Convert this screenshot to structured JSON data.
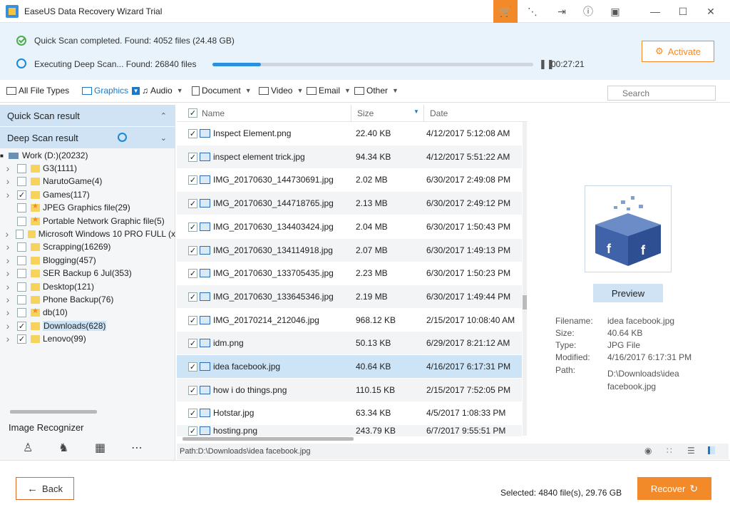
{
  "app": {
    "title": "EaseUS Data Recovery Wizard Trial"
  },
  "titlebar_icons": [
    "cart-icon",
    "share-icon",
    "exit-icon",
    "help-icon",
    "menu-icon",
    "minimize-icon",
    "maximize-icon",
    "close-icon"
  ],
  "status": {
    "quick_scan": "Quick Scan completed.  Found: 4052 files (24.48 GB)",
    "deep_scan": "Executing Deep Scan... Found: 26840 files",
    "progress": 0.15,
    "elapsed": "00:27:21",
    "activate_label": "Activate"
  },
  "filters": [
    {
      "label": "All File Types",
      "icon": "monitor-icon"
    },
    {
      "label": "Graphics",
      "icon": "image-icon"
    },
    {
      "label": "Audio",
      "icon": "music-icon"
    },
    {
      "label": "Document",
      "icon": "document-icon"
    },
    {
      "label": "Video",
      "icon": "video-icon"
    },
    {
      "label": "Email",
      "icon": "email-icon"
    },
    {
      "label": "Other",
      "icon": "folder-icon"
    }
  ],
  "search_placeholder": "Search",
  "sidebar": {
    "quick_scan_result": "Quick Scan result",
    "deep_scan_result": "Deep Scan result",
    "root": "Work (D:)(20232)",
    "items": [
      {
        "label": "G3(1111)",
        "checked": false,
        "arrow": true,
        "star": false
      },
      {
        "label": "NarutoGame(4)",
        "checked": false,
        "arrow": true,
        "star": false
      },
      {
        "label": "Games(117)",
        "checked": true,
        "arrow": true,
        "star": false
      },
      {
        "label": "JPEG Graphics file(29)",
        "checked": false,
        "arrow": false,
        "star": true
      },
      {
        "label": "Portable Network Graphic file(5)",
        "checked": false,
        "arrow": false,
        "star": true
      },
      {
        "label": "Microsoft Windows 10 PRO FULL (x",
        "checked": false,
        "arrow": true,
        "star": false
      },
      {
        "label": "Scrapping(16269)",
        "checked": false,
        "arrow": true,
        "star": false
      },
      {
        "label": "Blogging(457)",
        "checked": false,
        "arrow": true,
        "star": false
      },
      {
        "label": "SER Backup 6 Jul(353)",
        "checked": false,
        "arrow": true,
        "star": false
      },
      {
        "label": "Desktop(121)",
        "checked": false,
        "arrow": true,
        "star": false
      },
      {
        "label": "Phone Backup(76)",
        "checked": false,
        "arrow": true,
        "star": false
      },
      {
        "label": "db(10)",
        "checked": false,
        "arrow": true,
        "star": true
      },
      {
        "label": "Downloads(628)",
        "checked": true,
        "arrow": true,
        "star": false,
        "selected": true
      },
      {
        "label": "Lenovo(99)",
        "checked": true,
        "arrow": true,
        "star": false
      }
    ],
    "image_recognizer": "Image Recognizer",
    "recognizer_icons": [
      "person-icon",
      "animal-icon",
      "building-icon",
      "more-icon"
    ]
  },
  "list": {
    "col_name": "Name",
    "col_size": "Size",
    "col_date": "Date",
    "rows": [
      {
        "name": "Inspect Element.png",
        "size": "22.40 KB",
        "date": "4/12/2017 5:12:08 AM"
      },
      {
        "name": "inspect element trick.jpg",
        "size": "94.34 KB",
        "date": "4/12/2017 5:51:22 AM"
      },
      {
        "name": "IMG_20170630_144730691.jpg",
        "size": "2.02 MB",
        "date": "6/30/2017 2:49:08 PM"
      },
      {
        "name": "IMG_20170630_144718765.jpg",
        "size": "2.13 MB",
        "date": "6/30/2017 2:49:12 PM"
      },
      {
        "name": "IMG_20170630_134403424.jpg",
        "size": "2.04 MB",
        "date": "6/30/2017 1:50:43 PM"
      },
      {
        "name": "IMG_20170630_134114918.jpg",
        "size": "2.07 MB",
        "date": "6/30/2017 1:49:13 PM"
      },
      {
        "name": "IMG_20170630_133705435.jpg",
        "size": "2.23 MB",
        "date": "6/30/2017 1:50:23 PM"
      },
      {
        "name": "IMG_20170630_133645346.jpg",
        "size": "2.19 MB",
        "date": "6/30/2017 1:49:44 PM"
      },
      {
        "name": "IMG_20170214_212046.jpg",
        "size": "968.12 KB",
        "date": "2/15/2017 10:08:40 AM"
      },
      {
        "name": "idm.png",
        "size": "50.13 KB",
        "date": "6/29/2017 8:21:12 AM"
      },
      {
        "name": "idea facebook.jpg",
        "size": "40.64 KB",
        "date": "4/16/2017 6:17:31 PM",
        "selected": true
      },
      {
        "name": "how i do things.png",
        "size": "110.15 KB",
        "date": "2/15/2017 7:52:05 PM"
      },
      {
        "name": "Hotstar.jpg",
        "size": "63.34 KB",
        "date": "4/5/2017 1:08:33 PM"
      },
      {
        "name": "hosting.png",
        "size": "243.79 KB",
        "date": "6/7/2017 9:55:51 PM"
      }
    ],
    "path": "Path:D:\\Downloads\\idea facebook.jpg"
  },
  "preview": {
    "button": "Preview",
    "filename_label": "Filename:",
    "filename": "idea facebook.jpg",
    "size_label": "Size:",
    "size": "40.64 KB",
    "type_label": "Type:",
    "type": "JPG File",
    "modified_label": "Modified:",
    "modified": "4/16/2017 6:17:31 PM",
    "path_label": "Path:",
    "path_line1": "D:\\Downloads\\idea",
    "path_line2": "facebook.jpg"
  },
  "footer": {
    "back": "Back",
    "selected": "Selected: 4840 file(s), 29.76 GB",
    "recover": "Recover"
  },
  "colors": {
    "accent": "#f28a2a",
    "highlight": "#cde4f7",
    "progress": "#2a8fde"
  }
}
